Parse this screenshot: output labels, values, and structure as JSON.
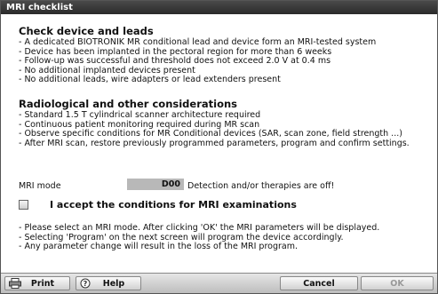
{
  "window": {
    "title": "MRI checklist"
  },
  "section1": {
    "title": "Check device and leads",
    "items": [
      "- A dedicated BIOTRONIK MR conditional lead and device form an MRI-tested system",
      "- Device has been implanted in the pectoral region for more than 6 weeks",
      "- Follow-up was successful and threshold does not exceed 2.0 V at 0.4 ms",
      "- No additional implanted devices present",
      "- No additional leads, wire adapters or lead extenders present"
    ]
  },
  "section2": {
    "title": "Radiological and other considerations",
    "items": [
      "- Standard 1.5 T cylindrical scanner architecture required",
      "- Continuous patient monitoring required during MR scan",
      "- Observe specific conditions for MR Conditional devices (SAR, scan zone, field strength ...)",
      "- After MRI scan, restore previously programmed parameters, program and confirm settings."
    ]
  },
  "mri_mode": {
    "label": "MRI mode",
    "value": "D00",
    "note": "Detection and/or therapies are off!"
  },
  "accept": {
    "label": "I accept the conditions for MRI examinations",
    "checked": false
  },
  "notes": [
    "- Please select an MRI mode. After clicking 'OK' the MRI parameters will be displayed.",
    "- Selecting 'Program' on the next screen will program the device accordingly.",
    "- Any parameter change will result in the loss of the MRI program."
  ],
  "buttons": {
    "print": "Print",
    "help": "Help",
    "cancel": "Cancel",
    "ok": "OK"
  },
  "icons": {
    "print": "printer-icon",
    "help": "help-icon"
  }
}
